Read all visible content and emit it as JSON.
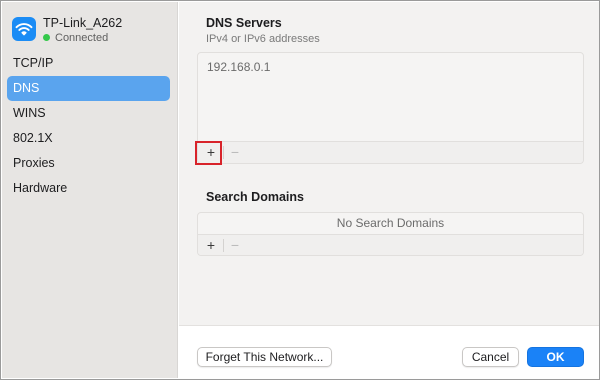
{
  "network": {
    "name": "TP-Link_A262",
    "status": "Connected",
    "icon": "wifi-icon",
    "accent_color": "#1b8cf5",
    "status_color": "#34c84a"
  },
  "sidebar": {
    "items": [
      {
        "label": "TCP/IP",
        "active": false
      },
      {
        "label": "DNS",
        "active": true
      },
      {
        "label": "WINS",
        "active": false
      },
      {
        "label": "802.1X",
        "active": false
      },
      {
        "label": "Proxies",
        "active": false
      },
      {
        "label": "Hardware",
        "active": false
      }
    ],
    "active_color": "#5aa4ee"
  },
  "dns_servers": {
    "title": "DNS Servers",
    "subtitle": "IPv4 or IPv6 addresses",
    "entries": [
      "192.168.0.1"
    ],
    "add_label": "+",
    "remove_label": "−"
  },
  "search_domains": {
    "title": "Search Domains",
    "empty_text": "No Search Domains",
    "add_label": "+",
    "remove_label": "−"
  },
  "footer": {
    "forget_label": "Forget This Network...",
    "cancel_label": "Cancel",
    "ok_label": "OK",
    "ok_color": "#1a82f7"
  }
}
